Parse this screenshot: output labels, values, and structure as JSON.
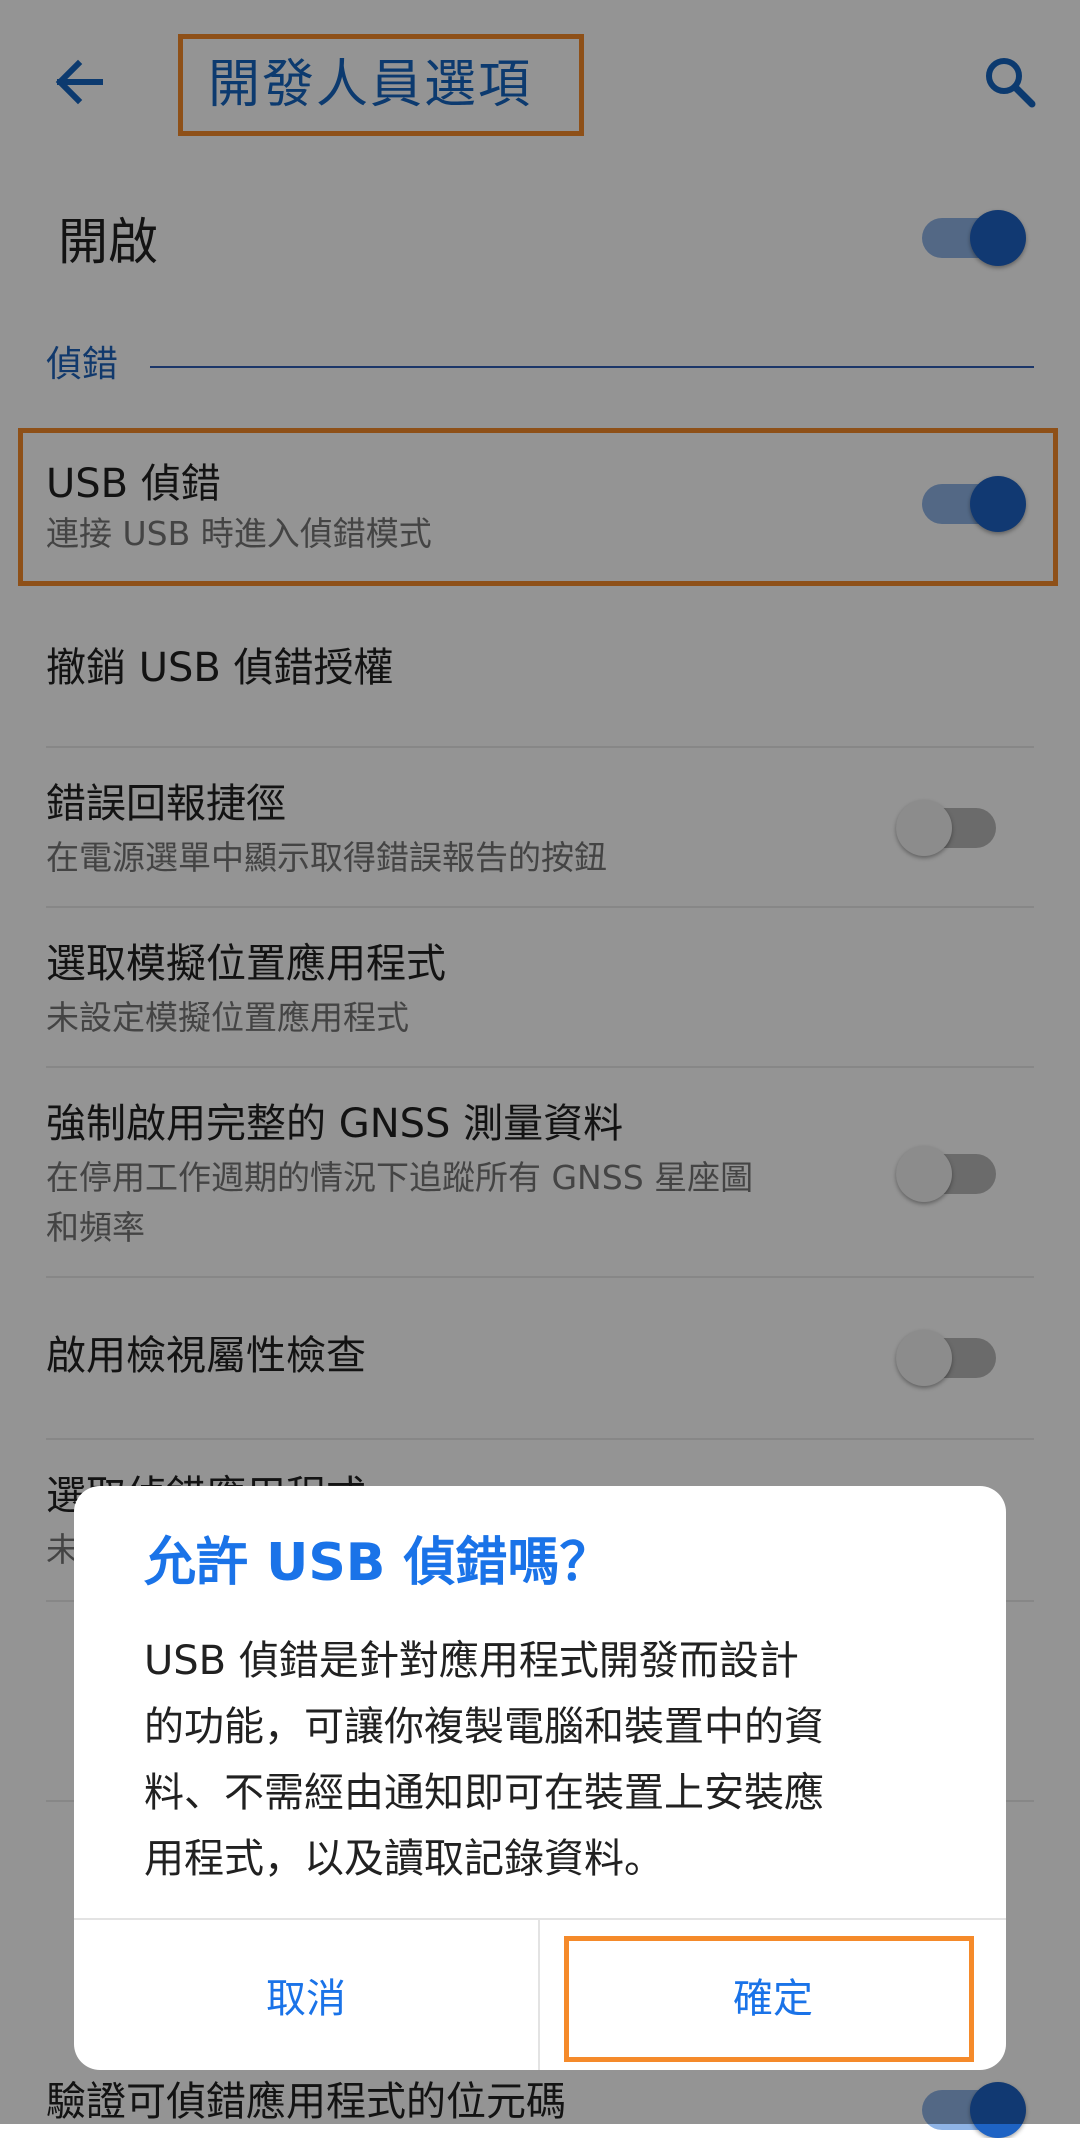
{
  "app_bar": {
    "title": "開發人員選項",
    "back_icon": "arrow-back-icon",
    "search_icon": "search-icon"
  },
  "master": {
    "label": "開啟",
    "enabled": true
  },
  "section": {
    "label": "偵錯"
  },
  "settings": [
    {
      "title": "USB 偵錯",
      "subtitle": "連接 USB 時進入偵錯模式",
      "toggle": "on"
    },
    {
      "title": "撤銷 USB 偵錯授權",
      "subtitle": "",
      "toggle": "none"
    },
    {
      "title": "錯誤回報捷徑",
      "subtitle": "在電源選單中顯示取得錯誤報告的按鈕",
      "toggle": "off"
    },
    {
      "title": "選取模擬位置應用程式",
      "subtitle": "未設定模擬位置應用程式",
      "toggle": "none"
    },
    {
      "title": "強制啟用完整的 GNSS 測量資料",
      "subtitle": "在停用工作週期的情況下追蹤所有 GNSS 星座圖",
      "subtitle2": "和頻率",
      "toggle": "off"
    },
    {
      "title": "啟用檢視屬性檢查",
      "subtitle": "",
      "toggle": "off"
    },
    {
      "title": "選取偵錯應用程式",
      "subtitle": "未",
      "toggle": "none"
    },
    {
      "title": "驗證可偵錯應用程式的位元碼",
      "subtitle": "",
      "toggle": "on"
    }
  ],
  "dialog": {
    "title": "允許 USB 偵錯嗎？",
    "body_lines": [
      "USB 偵錯是針對應用程式開發而設計",
      "的功能，可讓你複製電腦和裝置中的資",
      "料、不需經由通知即可在裝置上安裝應",
      "用程式，以及讀取記錄資料。"
    ],
    "cancel_label": "取消",
    "ok_label": "確定"
  },
  "colors": {
    "accent": "#1a73e8",
    "highlight": "#f58a2a",
    "toggle_on_thumb": "#1e63c4",
    "toggle_on_track": "#8fb4e6"
  }
}
